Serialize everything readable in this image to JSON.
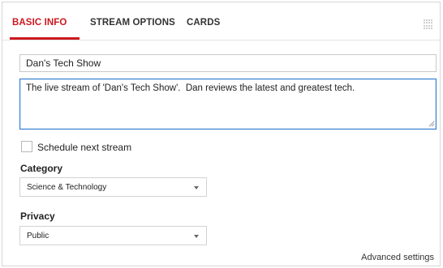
{
  "tabs": [
    {
      "label": "BASIC INFO",
      "active": true
    },
    {
      "label": "STREAM OPTIONS",
      "active": false
    },
    {
      "label": "CARDS",
      "active": false
    }
  ],
  "basic_info": {
    "title_value": "Dan's Tech Show",
    "description_value": "The live stream of 'Dan's Tech Show'.  Dan reviews the latest and greatest tech.",
    "schedule_label": "Schedule next stream",
    "schedule_checked": false,
    "category_label": "Category",
    "category_value": "Science & Technology",
    "privacy_label": "Privacy",
    "privacy_value": "Public",
    "advanced_label": "Advanced settings"
  },
  "colors": {
    "accent": "#cc181e",
    "focus_border": "#2e7bcf"
  },
  "icons": {
    "drag_handle": "grip-dots-icon",
    "dropdown_arrow": "chevron-down-icon",
    "resize": "resize-handle-icon"
  }
}
